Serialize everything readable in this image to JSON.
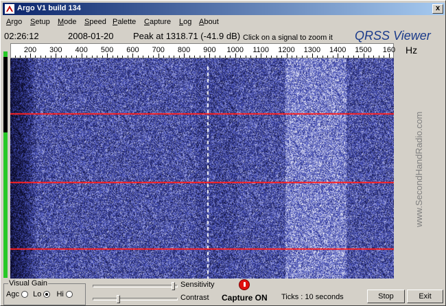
{
  "window": {
    "title": "Argo V1 build 134",
    "close_label": "x"
  },
  "menu": [
    {
      "label": "Argo",
      "key": "A"
    },
    {
      "label": "Setup",
      "key": "S"
    },
    {
      "label": "Mode",
      "key": "M"
    },
    {
      "label": "Speed",
      "key": "S"
    },
    {
      "label": "Palette",
      "key": "P"
    },
    {
      "label": "Capture",
      "key": "C"
    },
    {
      "label": "Log",
      "key": "L"
    },
    {
      "label": "About",
      "key": "A"
    }
  ],
  "status": {
    "time": "02:26:12",
    "date": "2008-01-20",
    "peak": "Peak at 1318.71 (-41.9 dB)",
    "hint": "Click on a signal to zoom it",
    "brand": "QRSS Viewer",
    "unit": "Hz"
  },
  "ruler": {
    "ticks": [
      "200",
      "300",
      "400",
      "500",
      "600",
      "700",
      "800",
      "900",
      "1000",
      "1100",
      "1200",
      "1300",
      "1400",
      "1500",
      "160"
    ]
  },
  "watermark": "www.SecondHandRadio.com",
  "controls": {
    "visual_gain": "Visual Gain",
    "agc": "Agc",
    "lo": "Lo",
    "hi": "Hi",
    "sensitivity": "Sensitivity",
    "contrast": "Contrast",
    "capture_status": "Capture ON",
    "ticks": "Ticks   : 10 seconds",
    "stop": "Stop",
    "exit": "Exit"
  },
  "colors": {
    "accent": "#0a246a",
    "marker": "#ff2020",
    "capture": "#e01010"
  }
}
